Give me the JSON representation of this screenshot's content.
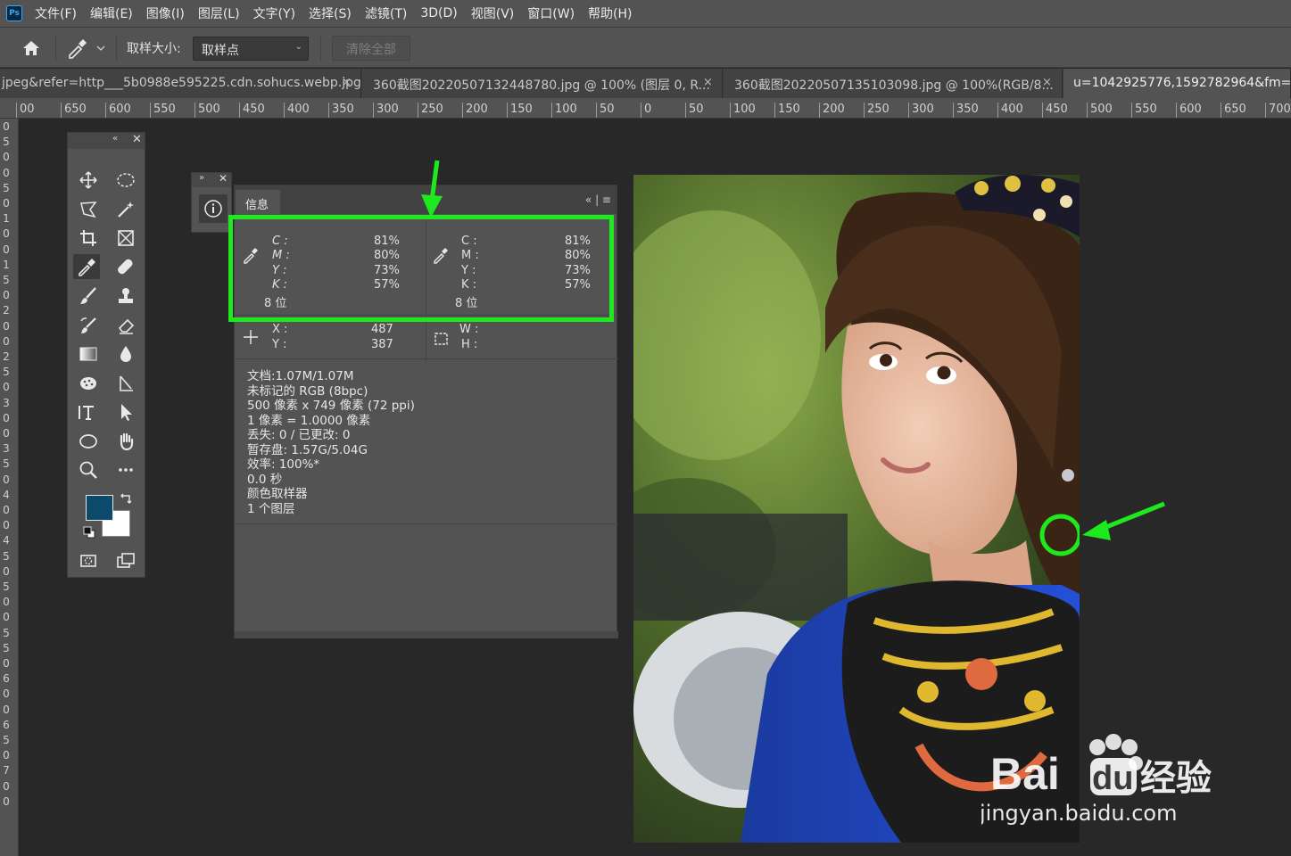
{
  "app": {
    "logo": "Ps"
  },
  "menu": [
    "文件(F)",
    "编辑(E)",
    "图像(I)",
    "图层(L)",
    "文字(Y)",
    "选择(S)",
    "滤镜(T)",
    "3D(D)",
    "视图(V)",
    "窗口(W)",
    "帮助(H)"
  ],
  "options": {
    "sample_size_label": "取样大小:",
    "sample_size_value": "取样点",
    "clear_all": "清除全部"
  },
  "tabs": [
    {
      "label": "jpeg&refer=http___5b0988e595225.cdn.sohucs.webp.jpg",
      "close": "×"
    },
    {
      "label": "360截图20220507132448780.jpg @ 100% (图层 0, R...",
      "close": "×"
    },
    {
      "label": "360截图20220507135103098.jpg @ 100%(RGB/8...",
      "close": "×"
    },
    {
      "label": "u=1042925776,1592782964&fm=253",
      "close": ""
    }
  ],
  "ruler_top": [
    "00",
    "650",
    "600",
    "550",
    "500",
    "450",
    "400",
    "350",
    "300",
    "250",
    "200",
    "150",
    "100",
    "50",
    "0",
    "50",
    "100",
    "150",
    "200",
    "250",
    "300",
    "350",
    "400",
    "450",
    "500",
    "550",
    "600",
    "650",
    "700"
  ],
  "ruler_left": [
    "0",
    "5",
    "0",
    "0",
    "5",
    "0",
    "1",
    "0",
    "0",
    "1",
    "5",
    "0",
    "2",
    "0",
    "0",
    "2",
    "5",
    "0",
    "3",
    "0",
    "0",
    "3",
    "5",
    "0",
    "4",
    "0",
    "0",
    "4",
    "5",
    "0",
    "5",
    "0",
    "0",
    "5",
    "5",
    "0",
    "6",
    "0",
    "0",
    "6",
    "5",
    "0",
    "7",
    "0",
    "0"
  ],
  "info_panel": {
    "tab": "信息",
    "left_cmyk": [
      {
        "label": "C :",
        "value": "81%"
      },
      {
        "label": "M :",
        "value": "80%"
      },
      {
        "label": "Y :",
        "value": "73%"
      },
      {
        "label": "K :",
        "value": "57%"
      }
    ],
    "left_bits": "8 位",
    "right_cmyk": [
      {
        "label": "C :",
        "value": "81%"
      },
      {
        "label": "M :",
        "value": "80%"
      },
      {
        "label": "Y :",
        "value": "73%"
      },
      {
        "label": "K :",
        "value": "57%"
      }
    ],
    "right_bits": "8 位",
    "x_label": "X :",
    "x_value": "487",
    "y_label": "Y :",
    "y_value": "387",
    "w_label": "W :",
    "h_label": "H :",
    "doc_lines": [
      "文档:1.07M/1.07M",
      "未标记的 RGB (8bpc)",
      "500 像素 x 749 像素 (72 ppi)",
      "1 像素 = 1.0000 像素",
      "丢失: 0 / 已更改: 0",
      "暂存盘: 1.57G/5.04G",
      "效率: 100%*",
      "0.0 秒",
      "颜色取样器",
      "1 个图层"
    ]
  },
  "colors": {
    "foreground": "#0b4a6a",
    "background": "#ffffff",
    "highlight": "#1ee81e"
  },
  "watermark": {
    "brand": "Bai",
    "brand2": "du",
    "suffix": "经验",
    "url": "jingyan.baidu.com"
  }
}
